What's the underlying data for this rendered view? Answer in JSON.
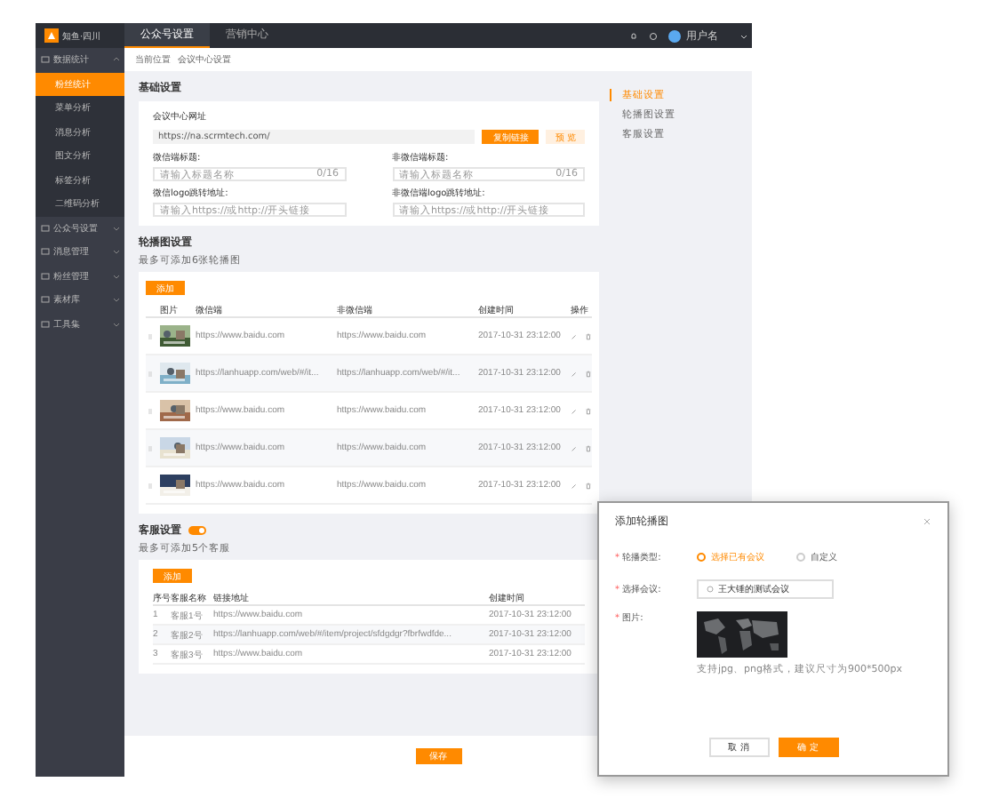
{
  "topbar": {
    "logo": "知鱼·四川",
    "tabs": [
      {
        "label": "公众号设置",
        "selected": true
      },
      {
        "label": "营销中心",
        "selected": false
      }
    ],
    "user": "用户名"
  },
  "sidebar": {
    "items": [
      {
        "label": "数据统计",
        "expanded": true,
        "children": [
          {
            "label": "粉丝统计",
            "selected": true
          },
          {
            "label": "菜单分析",
            "selected": false
          },
          {
            "label": "消息分析",
            "selected": false
          },
          {
            "label": "图文分析",
            "selected": false
          },
          {
            "label": "标签分析",
            "selected": false
          },
          {
            "label": "二维码分析",
            "selected": false
          }
        ]
      },
      {
        "label": "公众号设置",
        "expanded": false
      },
      {
        "label": "消息管理",
        "expanded": false
      },
      {
        "label": "粉丝管理",
        "expanded": false
      },
      {
        "label": "素材库",
        "expanded": false
      },
      {
        "label": "工具集",
        "expanded": false
      }
    ]
  },
  "breadcrumb": [
    "当前位置",
    "会议中心设置"
  ],
  "basic": {
    "title": "基础设置",
    "url_label": "会议中心网址",
    "url": "https://na.scrmtech.com/",
    "copy": "复制链接",
    "preview": "预 览",
    "fields": [
      {
        "label": "微信端标题:",
        "placeholder": "请输入标题名称",
        "counter": "0/16"
      },
      {
        "label": "非微信端标题:",
        "placeholder": "请输入标题名称",
        "counter": "0/16"
      },
      {
        "label": "微信logo跳转地址:",
        "placeholder": "请输入https://或http://开头链接"
      },
      {
        "label": "非微信端logo跳转地址:",
        "placeholder": "请输入https://或http://开头链接"
      }
    ]
  },
  "anchors": [
    {
      "label": "基础设置",
      "selected": true
    },
    {
      "label": "轮播图设置",
      "selected": false
    },
    {
      "label": "客服设置",
      "selected": false
    }
  ],
  "carousel": {
    "title": "轮播图设置",
    "hint": "最多可添加6张轮播图",
    "add": "添加",
    "columns": [
      "图片",
      "微信端",
      "非微信端",
      "创建时间",
      "操作"
    ],
    "rows": [
      {
        "wechat": "https://www.baidu.com",
        "other": "https://www.baidu.com",
        "time": "2017-10-31  23:12:00"
      },
      {
        "wechat": "https://lanhuapp.com/web/#/it...",
        "other": "https://lanhuapp.com/web/#/it...",
        "time": "2017-10-31  23:12:00"
      },
      {
        "wechat": "https://www.baidu.com",
        "other": "https://www.baidu.com",
        "time": "2017-10-31  23:12:00"
      },
      {
        "wechat": "https://www.baidu.com",
        "other": "https://www.baidu.com",
        "time": "2017-10-31  23:12:00"
      },
      {
        "wechat": "https://www.baidu.com",
        "other": "https://www.baidu.com",
        "time": "2017-10-31  23:12:00"
      }
    ]
  },
  "service": {
    "title": "客服设置",
    "on": true,
    "hint": "最多可添加5个客服",
    "add": "添加",
    "columns": [
      "序号",
      "客服名称",
      "链接地址",
      "创建时间"
    ],
    "rows": [
      {
        "no": "1",
        "name": "客服1号",
        "link": "https://www.baidu.com",
        "time": "2017-10-31  23:12:00"
      },
      {
        "no": "2",
        "name": "客服2号",
        "link": "https://lanhuapp.com/web/#/item/project/sfdgdgr?fbrfwdfde...",
        "time": "2017-10-31  23:12:00"
      },
      {
        "no": "3",
        "name": "客服3号",
        "link": "https://www.baidu.com",
        "time": "2017-10-31  23:12:00"
      }
    ]
  },
  "save": "保存",
  "dialog": {
    "title": "添加轮播图",
    "type_mark": "*",
    "meeting_mark": "*",
    "image_mark": "*",
    "type_label": "轮播类型:",
    "options": [
      {
        "label": "选择已有会议",
        "selected": true
      },
      {
        "label": "自定义",
        "selected": false
      }
    ],
    "meeting_label": "选择会议:",
    "meeting": "王大锤的测试会议",
    "image_label": "图片:",
    "image_hint": "支持jpg、png格式，建议尺寸为900*500px",
    "cancel": "取 消",
    "ok": "确 定"
  }
}
